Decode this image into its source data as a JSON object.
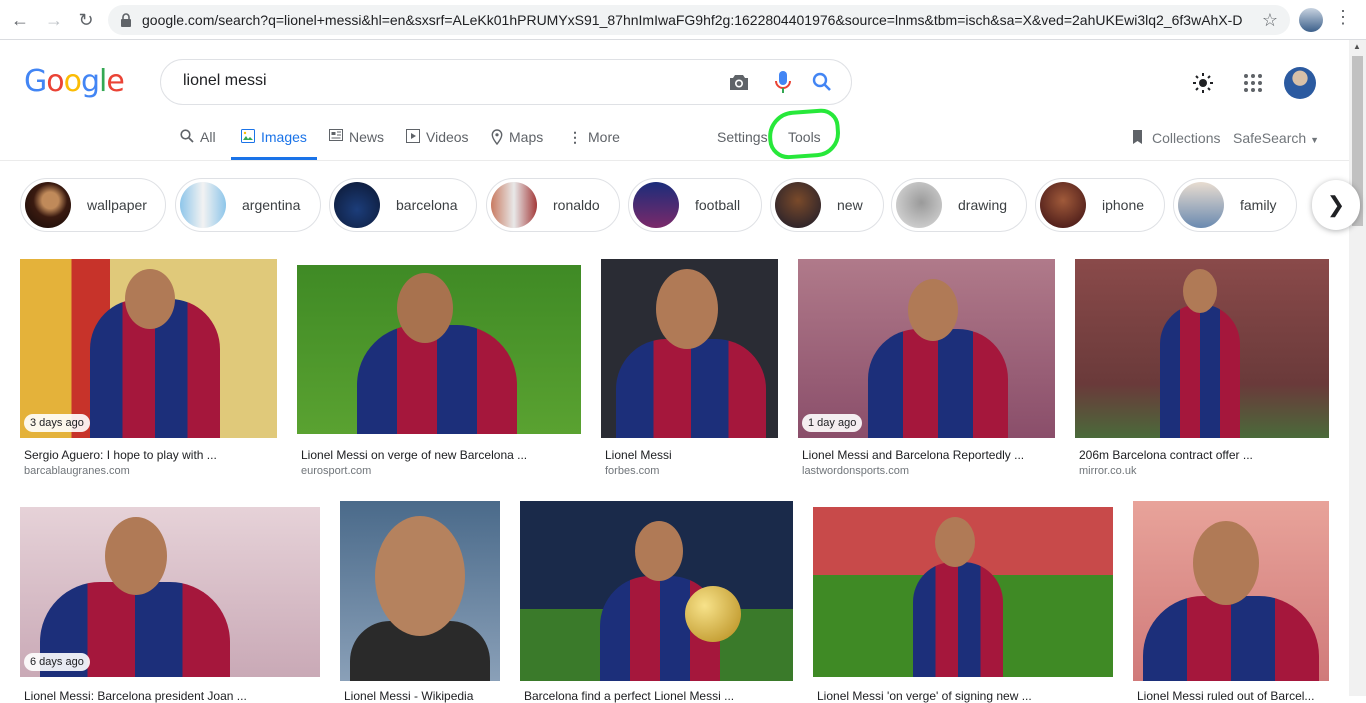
{
  "browser": {
    "url": "google.com/search?q=lionel+messi&hl=en&sxsrf=ALeKk01hPRUMYxS91_87hnImIwaFG9hf2g:1622804401976&source=lnms&tbm=isch&sa=X&ved=2ahUKEwi3lq2_6f3wAhX-D..."
  },
  "search": {
    "query": "lionel messi"
  },
  "logo": [
    "G",
    "o",
    "o",
    "g",
    "l",
    "e"
  ],
  "tabs": {
    "all": "All",
    "images": "Images",
    "news": "News",
    "videos": "Videos",
    "maps": "Maps",
    "more": "More",
    "settings": "Settings",
    "tools": "Tools"
  },
  "right_links": {
    "collections": "Collections",
    "safesearch": "SafeSearch"
  },
  "chips": [
    "wallpaper",
    "argentina",
    "barcelona",
    "ronaldo",
    "football",
    "new",
    "drawing",
    "iphone",
    "family"
  ],
  "results": [
    {
      "title": "Sergio Aguero: I hope to play with ...",
      "source": "barcablaugranes.com",
      "ago": "3 days ago"
    },
    {
      "title": "Lionel Messi on verge of new Barcelona ...",
      "source": "eurosport.com",
      "ago": ""
    },
    {
      "title": "Lionel Messi",
      "source": "forbes.com",
      "ago": ""
    },
    {
      "title": "Lionel Messi and Barcelona Reportedly ...",
      "source": "lastwordonsports.com",
      "ago": "1 day ago"
    },
    {
      "title": "206m Barcelona contract offer ...",
      "source": "mirror.co.uk",
      "ago": ""
    },
    {
      "title": "Lionel Messi: Barcelona president Joan ...",
      "source": "",
      "ago": "6 days ago"
    },
    {
      "title": "Lionel Messi - Wikipedia",
      "source": "",
      "ago": ""
    },
    {
      "title": "Barcelona find a perfect Lionel Messi ...",
      "source": "",
      "ago": ""
    },
    {
      "title": "Lionel Messi 'on verge' of signing new ...",
      "source": "",
      "ago": ""
    },
    {
      "title": "Lionel Messi ruled out of Barcel...",
      "source": "",
      "ago": ""
    }
  ],
  "colors": {
    "brand_blue": "#4285f4",
    "brand_red": "#ea4335",
    "brand_yellow": "#fbbc05",
    "brand_green": "#34a853",
    "active_tab": "#1a73e8",
    "annotation": "#27e83a"
  }
}
